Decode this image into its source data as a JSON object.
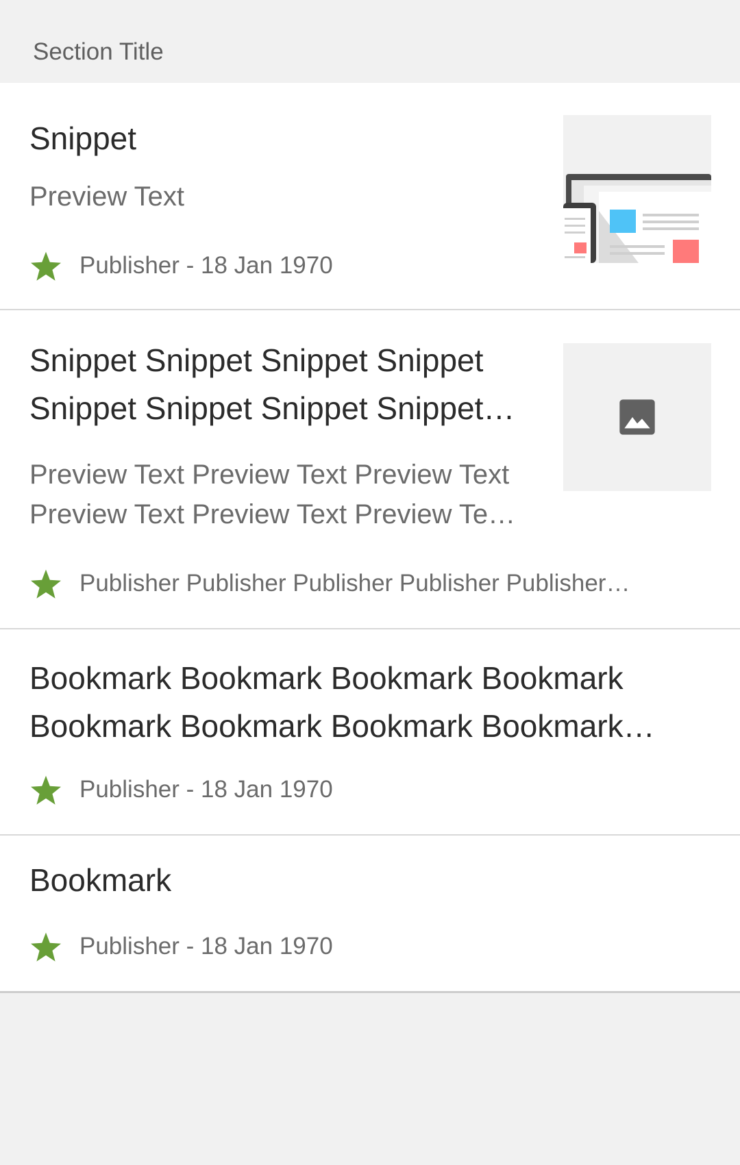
{
  "section": {
    "title": "Section Title"
  },
  "items": [
    {
      "title": "Snippet",
      "preview": "Preview Text",
      "meta": "Publisher - 18 Jan 1970",
      "thumbnail": "article-illustration",
      "star_color": "#689f38"
    },
    {
      "title": "Snippet Snippet Snippet Snippet Snippet Snippet Snippet Snippet…",
      "preview": "Preview Text Preview Text Preview Text Preview Text Preview Text Preview Te…",
      "meta": "Publisher Publisher Publisher Publisher Publisher…",
      "thumbnail": "image-placeholder-icon",
      "star_color": "#689f38"
    },
    {
      "title": "Bookmark Bookmark Bookmark Bookmark Bookmark Bookmark Bookmark Bookmark…",
      "meta": "Publisher - 18 Jan 1970",
      "star_color": "#689f38"
    },
    {
      "title": "Bookmark",
      "meta": "Publisher - 18 Jan 1970",
      "star_color": "#689f38"
    }
  ]
}
